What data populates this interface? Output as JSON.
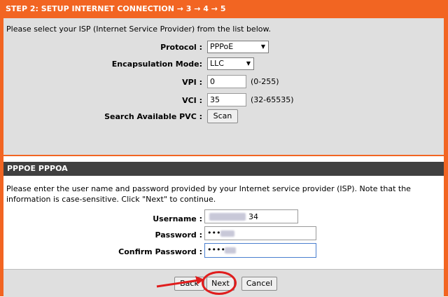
{
  "step_header": "STEP 2: SETUP INTERNET CONNECTION → 3 → 4 → 5",
  "isp": {
    "intro": "Please select your ISP (Internet Service Provider) from the list below.",
    "protocol_label": "Protocol :",
    "protocol_value": "PPPoE",
    "encapsulation_label": "Encapsulation Mode:",
    "encapsulation_value": "LLC",
    "vpi_label": "VPI :",
    "vpi_value": "0",
    "vpi_hint": "(0-255)",
    "vci_label": "VCI :",
    "vci_value": "35",
    "vci_hint": "(32-65535)",
    "search_label": "Search Available PVC :",
    "scan_button": "Scan"
  },
  "pppoe": {
    "header": "PPPOE PPPOA",
    "description": "Please enter the user name and password provided by your Internet service provider (ISP). Note that the information is case-sensitive. Click \"Next\" to continue.",
    "username_label": "Username :",
    "username_visible_suffix": "34",
    "password_label": "Password :",
    "password_value": "•••",
    "confirm_label": "Confirm Password :",
    "confirm_value": "••••"
  },
  "buttons": {
    "back": "Back",
    "next": "Next",
    "cancel": "Cancel"
  },
  "colors": {
    "brand_orange": "#f26522",
    "panel_gray": "#dfdfdf",
    "section_dark": "#404040",
    "annotation_red": "#e01d1d"
  }
}
